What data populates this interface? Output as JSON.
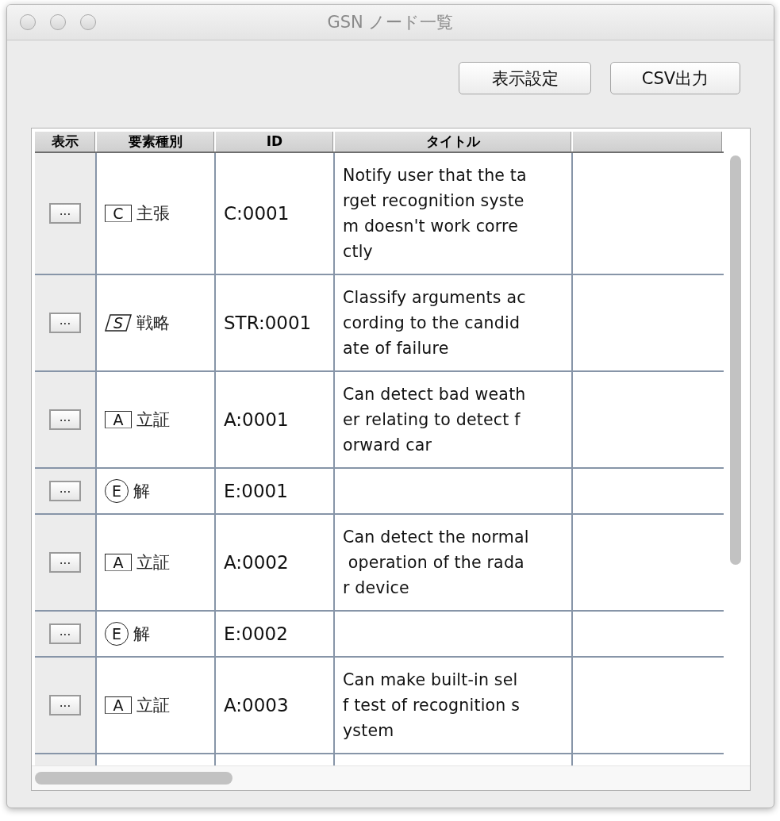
{
  "window": {
    "title": "GSN ノード一覧"
  },
  "toolbar": {
    "buttons": [
      "表示設定",
      "CSV出力"
    ]
  },
  "table": {
    "columns": [
      "表示",
      "要素種別",
      "ID",
      "タイトル"
    ],
    "rows": [
      {
        "button": "...",
        "kind": "box",
        "symbol": "C",
        "type": "主張",
        "id": "C:0001",
        "title": [
          "Notify user that the ta",
          "rget recognition syste",
          "m doesn't work corre",
          "ctly"
        ]
      },
      {
        "button": "...",
        "kind": "parallelogram",
        "symbol": "S",
        "type": "戦略",
        "id": "STR:0001",
        "title": [
          "Classify arguments ac",
          "cording to the candid",
          "ate of failure"
        ]
      },
      {
        "button": "...",
        "kind": "box",
        "symbol": "A",
        "type": "立証",
        "id": "A:0001",
        "title": [
          "Can detect bad weath",
          "er relating to detect f",
          "orward car"
        ]
      },
      {
        "button": "...",
        "kind": "circle",
        "symbol": "E",
        "type": "解",
        "id": "E:0001",
        "title": []
      },
      {
        "button": "...",
        "kind": "box",
        "symbol": "A",
        "type": "立証",
        "id": "A:0002",
        "title": [
          "Can detect the normal",
          " operation of the rada",
          "r device"
        ]
      },
      {
        "button": "...",
        "kind": "circle",
        "symbol": "E",
        "type": "解",
        "id": "E:0002",
        "title": []
      },
      {
        "button": "...",
        "kind": "box",
        "symbol": "A",
        "type": "立証",
        "id": "A:0003",
        "title": [
          "Can make built-in sel",
          "f test of recognition s",
          "ystem"
        ]
      }
    ]
  }
}
